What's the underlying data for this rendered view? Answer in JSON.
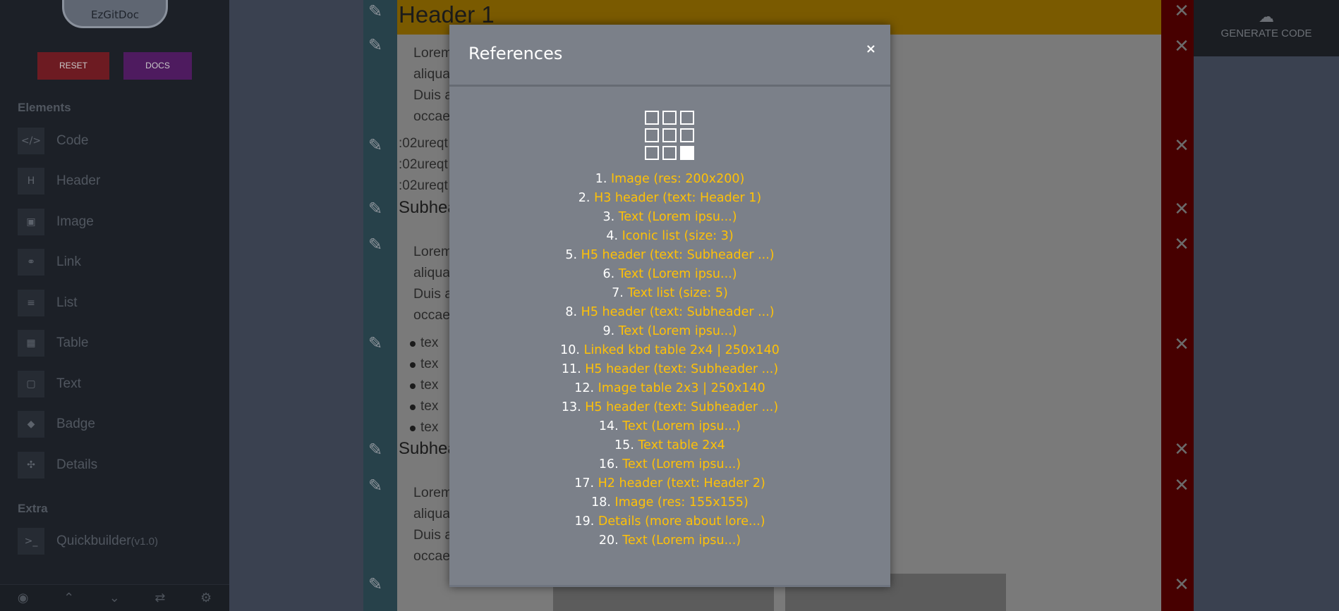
{
  "sidebar": {
    "logo": "EzGitDoc",
    "reset_label": "RESET",
    "docs_label": "DOCS",
    "elements_title": "Elements",
    "extra_title": "Extra",
    "items": [
      {
        "label": "Code",
        "icon": "</>"
      },
      {
        "label": "Header",
        "icon": "H"
      },
      {
        "label": "Image",
        "icon": "▣"
      },
      {
        "label": "Link",
        "icon": "⚭"
      },
      {
        "label": "List",
        "icon": "≡"
      },
      {
        "label": "Table",
        "icon": "▦"
      },
      {
        "label": "Text",
        "icon": "▢"
      },
      {
        "label": "Badge",
        "icon": "◆"
      },
      {
        "label": "Details",
        "icon": "✣"
      }
    ],
    "quickbuilder": {
      "label": "Quickbuilder",
      "version": "(v1.0)",
      "icon": ">_"
    }
  },
  "doc": {
    "h1": "Header 1",
    "para_a": "Lorem                                                                                            mpor incididunt ut labore et dolore magna",
    "para_b": "aliqua                                                                                           nisi ut aliquip ex ea commodo consequat.",
    "para_c": "Duis a                                                                                           e eu fugiat nulla pariatur. Excepteur sint",
    "para_d": "occae                                                                                                 id est laborum.",
    "small_lines": [
      ":02ureqt",
      ":02ureqt",
      ":02ureqt"
    ],
    "subheader": "Subhea",
    "bullets": [
      "tex",
      "tex",
      "tex",
      "tex",
      "tex"
    ]
  },
  "generate_label": "GENERATE CODE",
  "modal": {
    "title": "References",
    "close": "×",
    "refs": [
      {
        "num": "1.",
        "label": "Image (res: 200x200)"
      },
      {
        "num": "2.",
        "label": "H3 header (text: Header 1)"
      },
      {
        "num": "3.",
        "label": "Text (Lorem ipsu...)"
      },
      {
        "num": "4.",
        "label": "Iconic list (size: 3)"
      },
      {
        "num": "5.",
        "label": "H5 header (text: Subheader ...)"
      },
      {
        "num": "6.",
        "label": "Text (Lorem ipsu...)"
      },
      {
        "num": "7.",
        "label": "Text list (size: 5)"
      },
      {
        "num": "8.",
        "label": "H5 header (text: Subheader ...)"
      },
      {
        "num": "9.",
        "label": "Text (Lorem ipsu...)"
      },
      {
        "num": "10.",
        "label": "Linked kbd table 2x4 | 250x140"
      },
      {
        "num": "11.",
        "label": "H5 header (text: Subheader ...)"
      },
      {
        "num": "12.",
        "label": "Image table 2x3 | 250x140"
      },
      {
        "num": "13.",
        "label": "H5 header (text: Subheader ...)"
      },
      {
        "num": "14.",
        "label": "Text (Lorem ipsu...)"
      },
      {
        "num": "15.",
        "label": "Text table 2x4"
      },
      {
        "num": "16.",
        "label": "Text (Lorem ipsu...)"
      },
      {
        "num": "17.",
        "label": "H2 header (text: Header 2)"
      },
      {
        "num": "18.",
        "label": "Image (res: 155x155)"
      },
      {
        "num": "19.",
        "label": "Details (more about lore...)"
      },
      {
        "num": "20.",
        "label": "Text (Lorem ipsu...)"
      }
    ]
  },
  "colors": {
    "accent": "#ffc107",
    "reset": "#dc3545",
    "docs": "#9c27b0",
    "header_bg": "#ffb300",
    "delete": "#c00000"
  }
}
